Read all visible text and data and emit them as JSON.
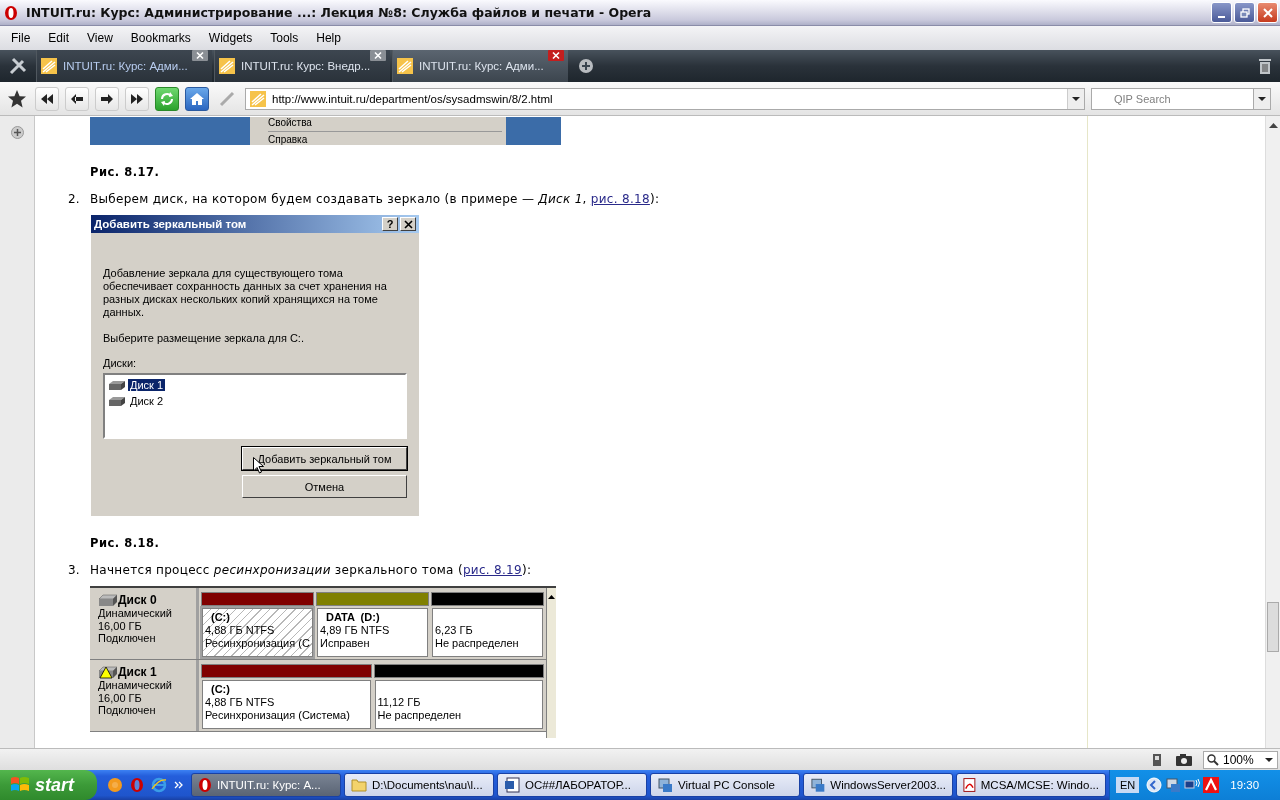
{
  "window": {
    "title": "INTUIT.ru: Курс: Администрирование ...: Лекция №8: Служба файлов и печати - Opera"
  },
  "menu": [
    "File",
    "Edit",
    "View",
    "Bookmarks",
    "Widgets",
    "Tools",
    "Help"
  ],
  "tabs": [
    {
      "label": "INTUIT.ru: Курс: Адми...",
      "selected": false
    },
    {
      "label": "INTUIT.ru: Курс: Внедр...",
      "selected": false
    },
    {
      "label": "INTUIT.ru: Курс: Адми...",
      "selected": true
    }
  ],
  "address": {
    "url": "http://www.intuit.ru/department/os/sysadmswin/8/2.html"
  },
  "search": {
    "placeholder": "QIP Search"
  },
  "article": {
    "figure_top": {
      "menu_items": [
        "Свойства",
        "Справка"
      ],
      "caption": "Рис. 8.17."
    },
    "step_2": {
      "number": "2.",
      "text_before": "Выберем диск, на котором будем создавать зеркало (в примере — *Диск 1*, ",
      "link": "рис. 8.18",
      "text_after": "):"
    },
    "dialog": {
      "title": "Добавить зеркальный том",
      "help": "?",
      "description": "Добавление зеркала для существующего тома обеспечивает сохранность данных за счет хранения  на разных дисках нескольких копий хранящихся на томе данных.",
      "prompt": "Выберите размещение зеркала для C:.",
      "list_label": "Диски:",
      "disks": [
        {
          "label": "Диск 1",
          "selected": true
        },
        {
          "label": "Диск 2",
          "selected": false
        }
      ],
      "buttons": [
        {
          "label": "Добавить зеркальный том",
          "kind": "default"
        },
        {
          "label": "Отмена",
          "kind": "normal"
        }
      ],
      "caption": "Рис. 8.18."
    },
    "step_3": {
      "number": "3.",
      "text_before": "Начнется процесс *ресинхронизации* зеркального тома (",
      "link": "рис. 8.19",
      "text_after": "):"
    },
    "disk_map": {
      "disks": [
        {
          "name": "Диск 0",
          "type": "Динамический",
          "size": "16,00 ГБ",
          "status": "Подключен",
          "warning": false,
          "volumes": [
            {
              "label": "(C:)",
              "size": "4,88 ГБ NTFS",
              "state": "Ресинхронизация (С",
              "color": "#800000",
              "selected": true
            },
            {
              "label": "DATA  (D:)",
              "size": "4,89 ГБ NTFS",
              "state": "Исправен",
              "color": "#808000",
              "selected": false
            },
            {
              "size": "6,23 ГБ",
              "state": "Не распределен",
              "color": "#000000",
              "selected": false
            }
          ]
        },
        {
          "name": "Диск 1",
          "type": "Динамический",
          "size": "16,00 ГБ",
          "status": "Подключен",
          "warning": true,
          "volumes": [
            {
              "label": "(C:)",
              "size": "4,88 ГБ NTFS",
              "state": "Ресинхронизация (Система)",
              "color": "#800000",
              "selected": false
            },
            {
              "size": "11,12 ГБ",
              "state": "Не распределен",
              "color": "#000000",
              "selected": false
            }
          ]
        }
      ]
    }
  },
  "status_bar": {
    "zoom": "100%"
  },
  "taskbar": {
    "start": "start",
    "tasks": [
      {
        "label": "INTUIT.ru: Курс: А...",
        "kind": "opera",
        "selected": true
      },
      {
        "label": "D:\\Documents\\nau\\l...",
        "kind": "folder",
        "selected": false
      },
      {
        "label": "ОС##ЛАБОРАТОР...",
        "kind": "word",
        "selected": false
      },
      {
        "label": "Virtual PC Console",
        "kind": "vpc",
        "selected": false
      },
      {
        "label": "WindowsServer2003...",
        "kind": "vpc",
        "selected": false
      },
      {
        "label": "MCSA/MCSE: Windo...",
        "kind": "pdf",
        "selected": false
      }
    ],
    "language": "EN",
    "clock": "19:30"
  }
}
